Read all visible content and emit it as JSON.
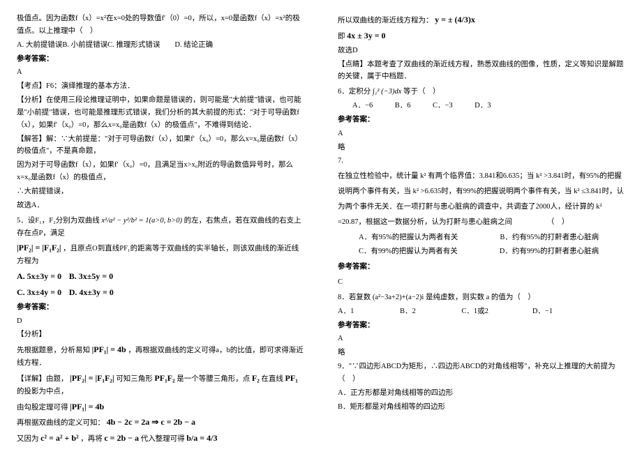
{
  "col1": {
    "q4_intro": "极值点。因为函数f（x）=x²在x=0处的导数值f′（0）=0，所以，x=0是函数f（x）=x²的极值点。以上推理中（　）",
    "q4_opts": "A. 大前提错误B. 小前提错误C. 推理形式错误　　D. 结论正确",
    "ans_label": "参考答案：",
    "q4_ans": "A",
    "q4_exam": "【考点】F6：演绎推理的基本方法．",
    "q4_analysis": "【分析】在使用三段论推理证明中，如果命题是错误的，则可能是\"大前提\"错误，也可能是\"小前提\"错误，也可能是推理形式错误，我们分析的其大前提的形式：\"对于可导函数f（x），如果f′（x₀）=0，那么x=x₀是函数f（x）的极值点\"，不难得到结论．",
    "q4_solve1": "【解答】解：∵大前提是：\"对于可导函数f（x），如果f′（x₀）=0，那么x=x₀是函数f（x）的极值点\"，不是真命题，",
    "q4_solve2": "因为对于可导函数f（x），如果f′（x₀）=0，且满足当x>x₀附近的导函数值异号时，那么x=x₀是函数f（x）的极值点，",
    "q4_solve3": "∴大前提错误，",
    "q4_solve4": "故选A．",
    "q5_stem_a": "5．设F₁，F₂分别为双曲线",
    "q5_formula1": "x²/a² − y²/b² = 1(a>0, b>0)",
    "q5_stem_b": "的左，右焦点，若在双曲线的右支上存在点P，满足",
    "q5_stem_c": "|PF₂| = |F₁F₂|",
    "q5_stem_d": "，且原点O到直线PF₁的距离等于双曲线的实半轴长，则该双曲线的渐近线方程为",
    "q5_optA": "A. 5x±3y = 0",
    "q5_optB": "B. 3x±5y = 0",
    "q5_optC": "C. 3x±4y = 0",
    "q5_optD": "D. 4x±3y = 0",
    "q5_ans": "D",
    "q5_ana_label": "【分析】",
    "q5_ana1a": "先根据题意，分析易知",
    "q5_ana1_f": "|PF₁| = 4b",
    "q5_ana1b": "，再根据双曲线的定义可得a，b的比值，即可求得渐近线方程．",
    "q5_det_label": "【详解】由题，",
    "q5_det_f1": "|PF₂| = |F₁F₂|",
    "q5_det1": "可知三角形",
    "q5_det_f2": "PF₁F₂",
    "q5_det2": "是一个等腰三角形，点",
    "q5_det_f3": "F₂",
    "q5_det3": "在直线",
    "q5_det_f4": "PF₁",
    "q5_det4": "的投影为中点，",
    "q5_line3a": "由勾股定理可得",
    "q5_line3_f": "|PF₁| = 4b",
    "q5_line4": "再根据双曲线的定义可知：",
    "q5_line4_f": "4b − 2c = 2a ⇒ c = 2b − a",
    "q5_line5a": "又因为",
    "q5_line5_f1": "c² = a² + b²",
    "q5_line5b": "，再将",
    "q5_line5_f2": "c = 2b − a",
    "q5_line5c": "代入整理可得",
    "q5_line5_f3": "b/a = 4/3"
  },
  "col2": {
    "c2_l1": "所以双曲线的渐近线方程为：",
    "c2_l1_f": "y = ± (4/3)x",
    "c2_l2a": "即 ",
    "c2_l2_f": "4x ± 3y = 0",
    "c2_l3": "故选D",
    "c2_exp": "【点睛】本题考查了双曲线的渐近线方程，熟悉双曲线的图像，性质，定义等知识是解题的关键，属于中档题．",
    "q6_stem": "6．定积分",
    "q6_formula": "∫₁² (−3)dx",
    "q6_stem_b": "等于（　）",
    "q6_opts": "　　A．−6　　　B．6　　　C．−3　　　D．3",
    "ans_label": "参考答案：",
    "q6_ans": "A",
    "q6_brief": "略",
    "q7_num": "7.",
    "q7_stem": "在独立性检验中，统计量 k² 有两个临界值：3.841和6.635；当 k² >3.841时，有95%的把握说明两个事件有关，当 k² >6.635时，有99%的把握说明两个事件有关，当 k² ≤3.841时，认为两个事件无关．在一项打鼾与患心脏病的调查中，共调查了2000人，经计算的 k² =20.87，根据这一数据分析，认为打鼾与患心脏病之间 　　　　　（　）",
    "q7_optA": "A．有95%的把握认为两者有关",
    "q7_optB": "B．约有95%的打鼾者患心脏病",
    "q7_optC": "C．有99%的把握认为两者有关",
    "q7_optD": "D．约有99%的打鼾者患心脏病",
    "q7_ans": "C",
    "q8_stem": "8．若复数 (a²−3a+2)+(a−2)i 是纯虚数，则实数 a 的值为（　）",
    "q8_opts": "A．1　　　　　　  B．2　　　　　　   C．1或2　　　　　　D．−1",
    "q8_ans": "A",
    "q8_brief": "略",
    "q9_stem": "9．\"∵四边形ABCD为矩形，∴四边形ABCD的对角线相等\"，补充以上推理的大前提为（　）",
    "q9_optA": "A．正方形都是对角线相等的四边形",
    "q9_optB": "B．矩形都是对角线相等的四边形"
  }
}
